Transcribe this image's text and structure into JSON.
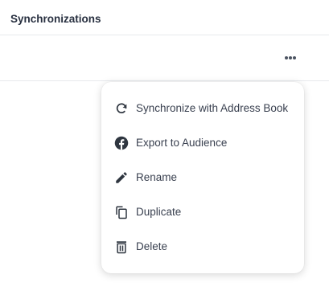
{
  "header": {
    "title": "Synchronizations"
  },
  "row": {
    "more_icon": "more-horizontal-icon"
  },
  "menu": {
    "items": [
      {
        "label": "Synchronize with Address Book",
        "icon": "sync-icon"
      },
      {
        "label": "Export to Audience",
        "icon": "facebook-icon"
      },
      {
        "label": "Rename",
        "icon": "pencil-icon"
      },
      {
        "label": "Duplicate",
        "icon": "copy-icon"
      },
      {
        "label": "Delete",
        "icon": "trash-icon"
      }
    ]
  },
  "colors": {
    "text": "#3a4150",
    "icon": "#2f3640",
    "divider": "#e7e9ed"
  }
}
